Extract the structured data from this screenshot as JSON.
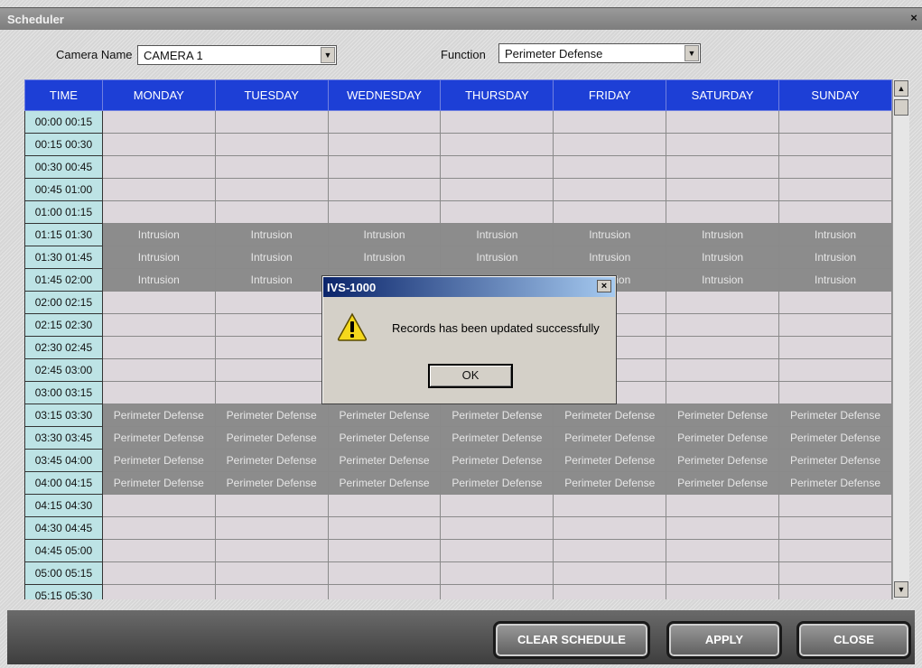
{
  "window": {
    "title": "Scheduler",
    "close_glyph": "×"
  },
  "camera": {
    "label": "Camera Name",
    "value": "CAMERA 1"
  },
  "function": {
    "label": "Function",
    "value": "Perimeter Defense"
  },
  "grid": {
    "headers": [
      "TIME",
      "MONDAY",
      "TUESDAY",
      "WEDNESDAY",
      "THURSDAY",
      "FRIDAY",
      "SATURDAY",
      "SUNDAY"
    ],
    "rows": [
      {
        "time": "00:00 00:15",
        "entry": ""
      },
      {
        "time": "00:15 00:30",
        "entry": ""
      },
      {
        "time": "00:30 00:45",
        "entry": ""
      },
      {
        "time": "00:45 01:00",
        "entry": ""
      },
      {
        "time": "01:00 01:15",
        "entry": ""
      },
      {
        "time": "01:15 01:30",
        "entry": "Intrusion"
      },
      {
        "time": "01:30 01:45",
        "entry": "Intrusion"
      },
      {
        "time": "01:45 02:00",
        "entry": "Intrusion"
      },
      {
        "time": "02:00 02:15",
        "entry": ""
      },
      {
        "time": "02:15 02:30",
        "entry": ""
      },
      {
        "time": "02:30 02:45",
        "entry": ""
      },
      {
        "time": "02:45 03:00",
        "entry": ""
      },
      {
        "time": "03:00 03:15",
        "entry": ""
      },
      {
        "time": "03:15 03:30",
        "entry": "Perimeter Defense"
      },
      {
        "time": "03:30 03:45",
        "entry": "Perimeter Defense"
      },
      {
        "time": "03:45 04:00",
        "entry": "Perimeter Defense"
      },
      {
        "time": "04:00 04:15",
        "entry": "Perimeter Defense"
      },
      {
        "time": "04:15 04:30",
        "entry": ""
      },
      {
        "time": "04:30 04:45",
        "entry": ""
      },
      {
        "time": "04:45 05:00",
        "entry": ""
      },
      {
        "time": "05:00 05:15",
        "entry": ""
      },
      {
        "time": "05:15 05:30",
        "entry": ""
      }
    ]
  },
  "buttons": {
    "clear": "CLEAR SCHEDULE",
    "apply": "APPLY",
    "close": "CLOSE"
  },
  "dialog": {
    "title": "IVS-1000",
    "message": "Records has been updated successfully",
    "ok": "OK",
    "close_glyph": "×",
    "icon": "warning-icon"
  }
}
